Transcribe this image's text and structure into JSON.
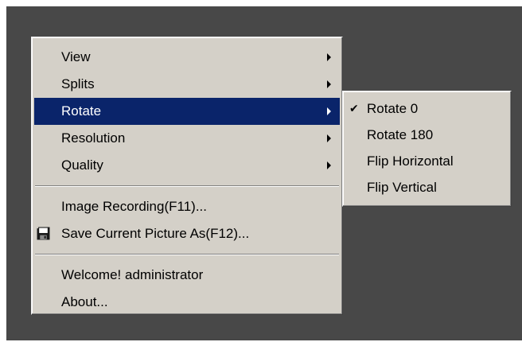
{
  "main_menu": {
    "items": [
      {
        "label": "View",
        "has_submenu": true
      },
      {
        "label": "Splits",
        "has_submenu": true
      },
      {
        "label": "Rotate",
        "has_submenu": true,
        "selected": true
      },
      {
        "label": "Resolution",
        "has_submenu": true
      },
      {
        "label": "Quality",
        "has_submenu": true
      }
    ],
    "recording_label": "Image Recording(F11)...",
    "save_label": "Save Current Picture As(F12)...",
    "save_icon": "floppy-disk-icon",
    "welcome_label": "Welcome! administrator",
    "about_label": "About..."
  },
  "rotate_submenu": {
    "items": [
      {
        "label": "Rotate 0",
        "checked": true
      },
      {
        "label": "Rotate 180"
      },
      {
        "label": "Flip Horizontal"
      },
      {
        "label": "Flip Vertical"
      }
    ],
    "check_glyph": "✔"
  },
  "colors": {
    "background": "#484848",
    "menu_face": "#d4d0c8",
    "highlight": "#0a246a",
    "highlight_text": "#ffffff"
  }
}
